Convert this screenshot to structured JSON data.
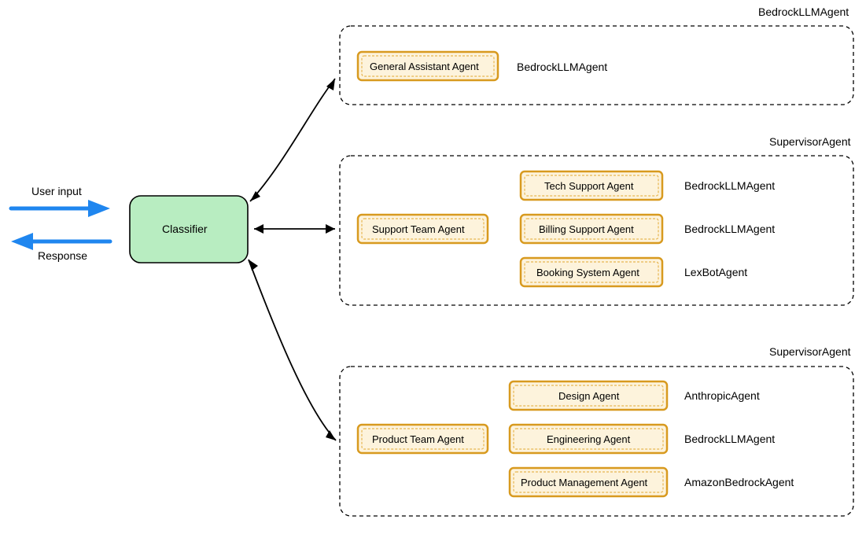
{
  "io": {
    "input_label": "User input",
    "output_label": "Response"
  },
  "classifier": {
    "label": "Classifier"
  },
  "groups": [
    {
      "title": "BedrockLLMAgent",
      "lead": null,
      "agents": [
        {
          "name": "General Assistant Agent",
          "type": "BedrockLLMAgent"
        }
      ]
    },
    {
      "title": "SupervisorAgent",
      "lead": {
        "name": "Support Team Agent"
      },
      "agents": [
        {
          "name": "Tech Support Agent",
          "type": "BedrockLLMAgent"
        },
        {
          "name": "Billing Support Agent",
          "type": "BedrockLLMAgent"
        },
        {
          "name": "Booking System Agent",
          "type": "LexBotAgent"
        }
      ]
    },
    {
      "title": "SupervisorAgent",
      "lead": {
        "name": "Product Team Agent"
      },
      "agents": [
        {
          "name": "Design Agent",
          "type": "AnthropicAgent"
        },
        {
          "name": "Engineering Agent",
          "type": "BedrockLLMAgent"
        },
        {
          "name": "Product Management Agent",
          "type": "AmazonBedrockAgent"
        }
      ]
    }
  ]
}
